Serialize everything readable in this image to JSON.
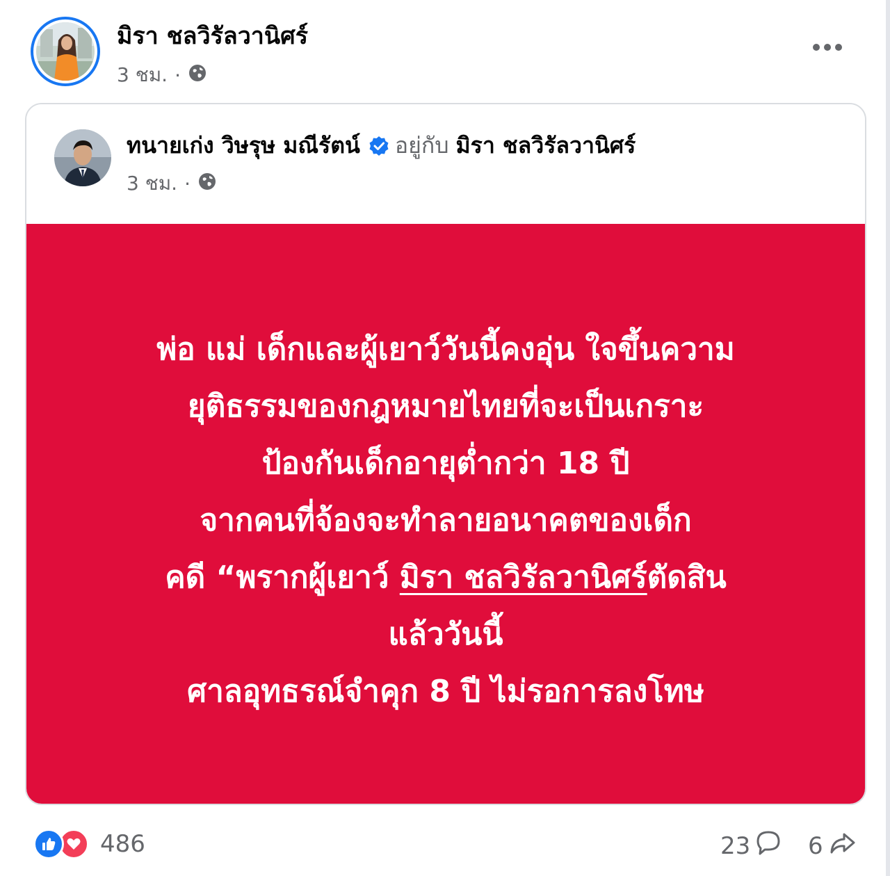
{
  "post": {
    "author": "มิรา ชลวิรัลวานิศร์",
    "time": "3 ชม.",
    "separator": "·",
    "privacy_icon": "globe-icon",
    "more_icon": "more-horizontal-icon"
  },
  "shared": {
    "author": "ทนายเก่ง วิษรุษ มณีรัตน์",
    "with_text": "อยู่กับ",
    "tagged": "มิรา ชลวิรัลวานิศร์",
    "time": "3 ชม.",
    "separator": "·",
    "verified_icon": "verified-badge-icon",
    "privacy_icon": "globe-icon"
  },
  "message": {
    "background": "#e00d3b",
    "lines": [
      "พ่อ แม่ เด็กและผู้เยาว์วันนี้คงอุ่น ใจขึ้นความ",
      "ยุติธรรมของกฎหมายไทยที่จะเป็นเกราะ",
      "ป้องกันเด็กอายุต่ำกว่า 18 ปี",
      "จากคนที่จ้องจะทำลายอนาคตของเด็ก"
    ],
    "line5_prefix": "คดี “พรากผู้เยาว์ ",
    "line5_underlined": "มิรา ชลวิรัลวานิศร์",
    "line5_suffix": "ตัดสิน",
    "line6": "แล้ววันนี้",
    "line7": "ศาลอุทธรณ์จำคุก 8 ปี ไม่รอการลงโทษ"
  },
  "footer": {
    "reaction_icons": [
      "like-icon",
      "love-icon"
    ],
    "reaction_count": "486",
    "comment_count": "23",
    "comment_icon": "comment-icon",
    "share_count": "6",
    "share_icon": "share-icon"
  },
  "colors": {
    "accent": "#1877f2",
    "love": "#f33e58",
    "meta_text": "#65676b"
  }
}
